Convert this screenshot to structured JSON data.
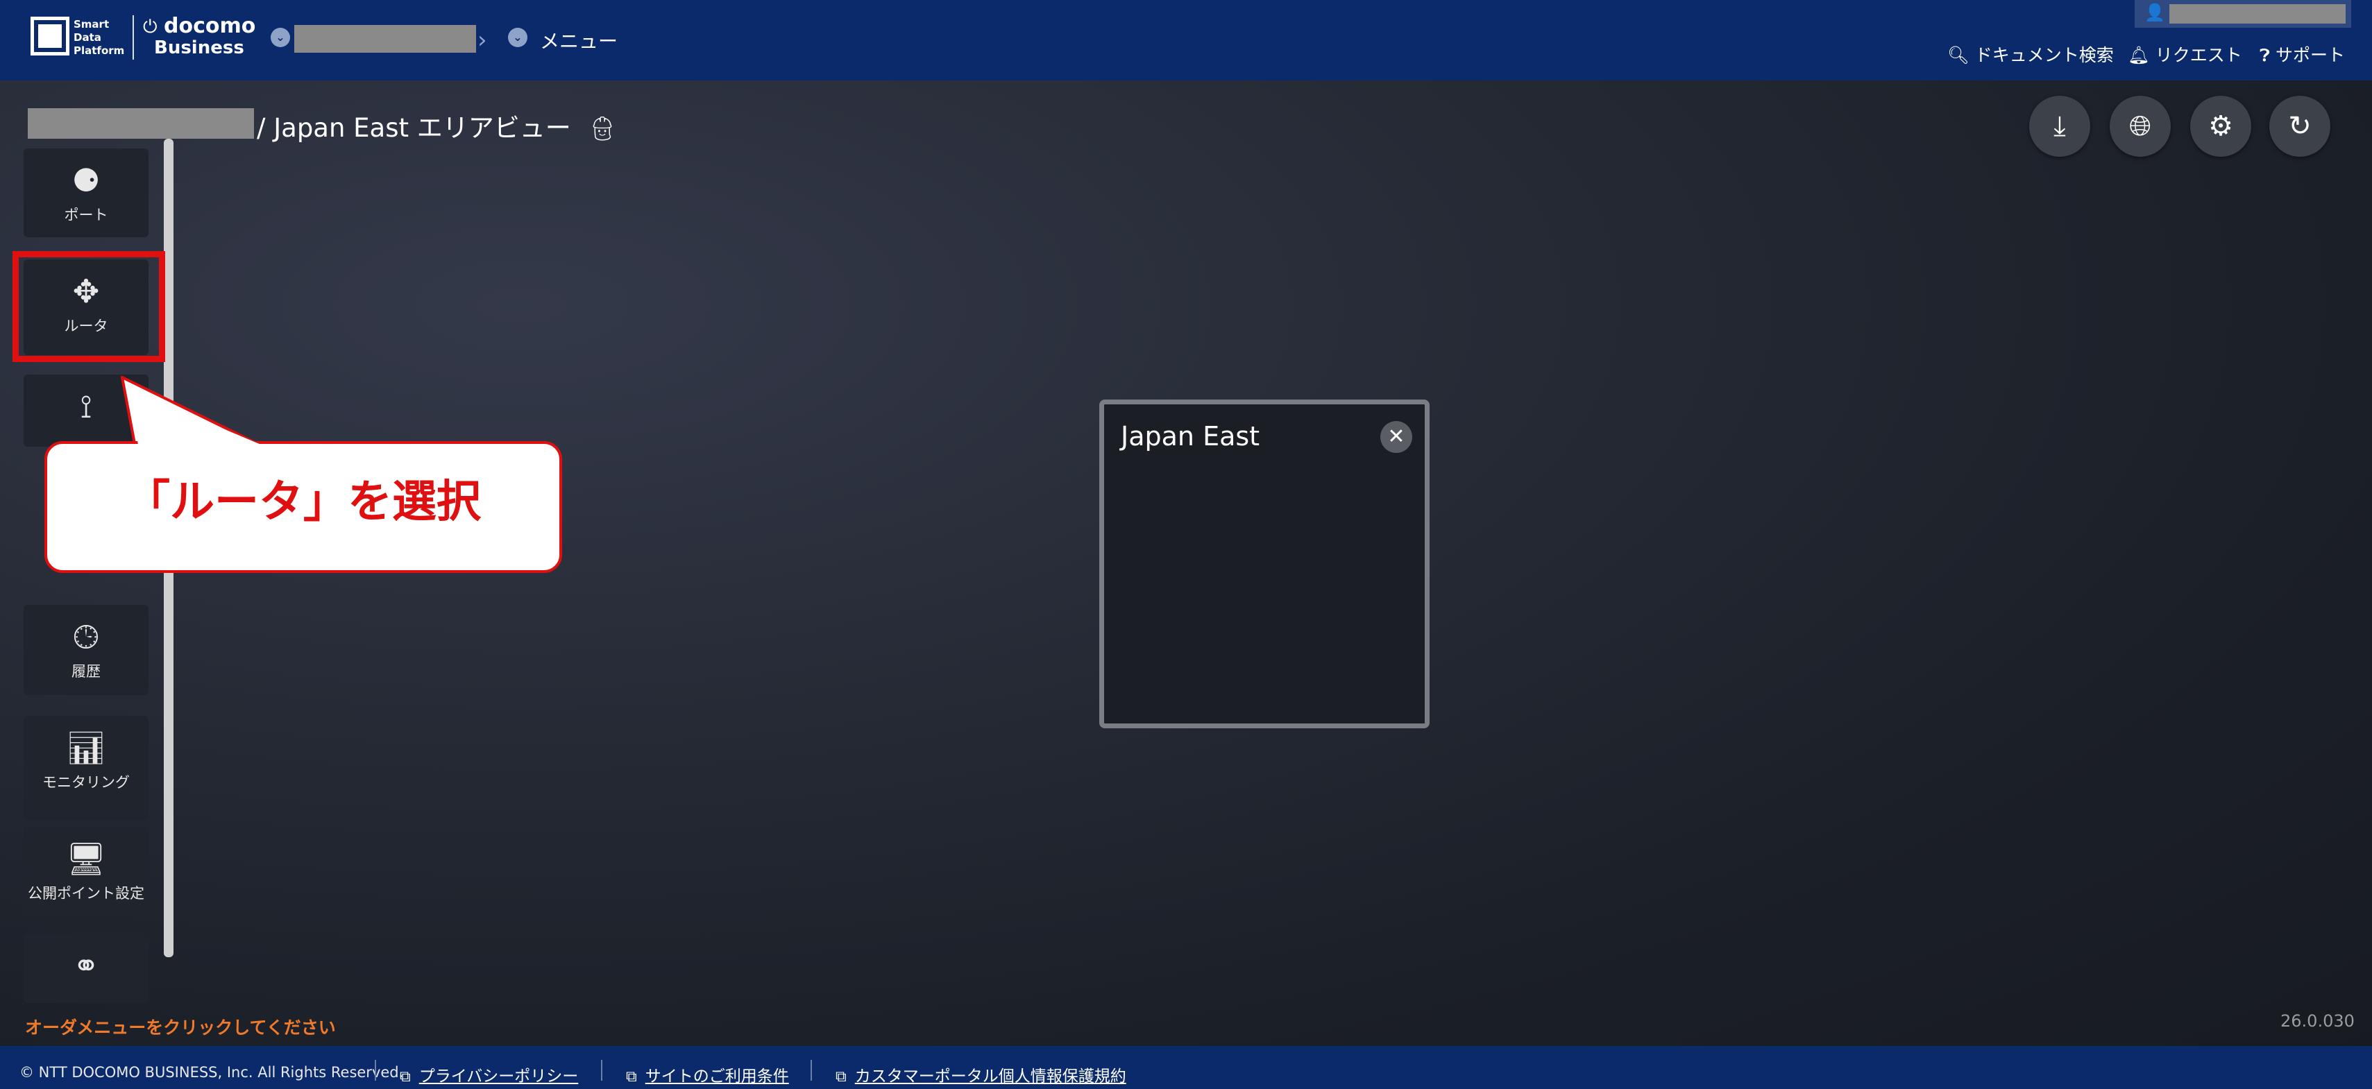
{
  "header": {
    "logo_line1": "Smart",
    "logo_line2": "Data",
    "logo_line3": "Platform",
    "brand": "docomo",
    "brand_sub": "Business",
    "menu_label": "メニュー",
    "doc_search_label": "ドキュメント検索",
    "request_label": "リクエスト",
    "support_label": "サポート"
  },
  "page": {
    "title": "/ Japan East エリアビュー"
  },
  "toolbar": {
    "download_icon": "download-icon",
    "globe_icon": "globe-icon",
    "settings_icon": "gear-icon",
    "refresh_icon": "refresh-icon"
  },
  "sidebar": {
    "items": [
      {
        "label": "ポート",
        "icon": "port-icon"
      },
      {
        "label": "ルータ",
        "icon": "router-icon"
      },
      {
        "label": "",
        "icon": "connection-icon"
      },
      {
        "label": "履歴",
        "icon": "history-icon"
      },
      {
        "label": "モニタリング",
        "icon": "monitoring-icon"
      },
      {
        "label": "公開ポイント設定",
        "icon": "public-point-icon"
      },
      {
        "label": "",
        "icon": "link-icon"
      }
    ]
  },
  "callout": {
    "text": "「ルータ」を選択"
  },
  "region": {
    "title": "Japan East"
  },
  "status": {
    "order_hint": "オーダメニューをクリックしてください",
    "version": "26.0.030"
  },
  "footer": {
    "copyright": "© NTT DOCOMO BUSINESS, Inc. All Rights Reserved.",
    "links": [
      "プライバシーポリシー",
      "サイトのご利用条件",
      "カスタマーポータル個人情報保護規約"
    ]
  },
  "colors": {
    "header_bg": "#0a2a6b",
    "highlight": "#e01010",
    "hint": "#f07a2a"
  }
}
